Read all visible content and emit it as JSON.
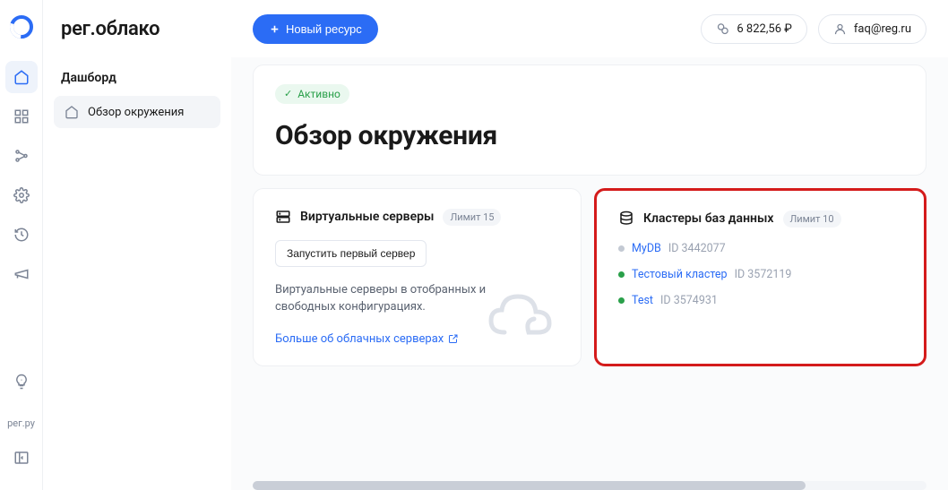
{
  "brand": "рег.облако",
  "rail_bottom_text": "рег.ру",
  "sidebar": {
    "section_title": "Дашборд",
    "nav_item_label": "Обзор окружения"
  },
  "topbar": {
    "new_resource_label": "Новый ресурс",
    "balance": "6 822,56 ₽",
    "user_email": "faq@reg.ru"
  },
  "header": {
    "status_label": "Активно",
    "page_title": "Обзор окружения"
  },
  "vservers": {
    "title": "Виртуальные серверы",
    "limit_label": "Лимит 15",
    "launch_button": "Запустить первый сервер",
    "description": "Виртуальные серверы в отобранных и свободных конфигурациях.",
    "link_label": "Больше об облачных серверах"
  },
  "dbclusters": {
    "title": "Кластеры баз данных",
    "limit_label": "Лимит 10",
    "items": [
      {
        "status": "gray",
        "name": "MyDB",
        "id": "ID 3442077"
      },
      {
        "status": "green",
        "name": "Тестовый кластер",
        "id": "ID 3572119"
      },
      {
        "status": "green",
        "name": "Test",
        "id": "ID 3574931"
      }
    ]
  }
}
